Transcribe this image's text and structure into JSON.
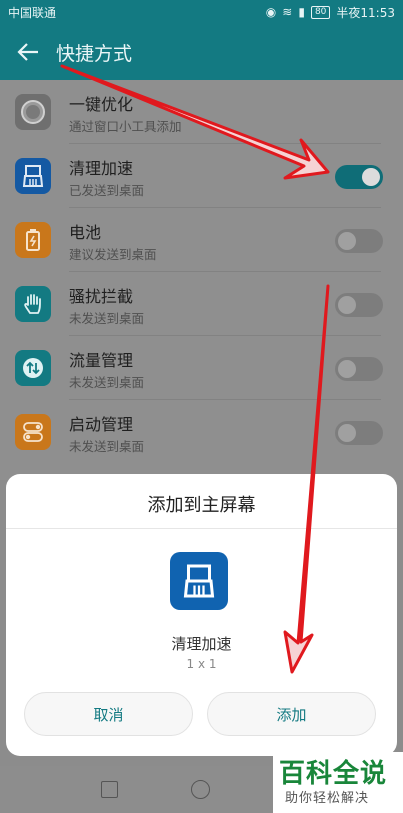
{
  "status_bar": {
    "carrier": "中国联通",
    "battery": "80",
    "time": "半夜11:53"
  },
  "app_bar": {
    "title": "快捷方式"
  },
  "shortcuts": [
    {
      "name": "一键优化",
      "status": "通过窗口小工具添加",
      "icon": "optimize-icon",
      "color": "#6f6f6f",
      "enabled": null
    },
    {
      "name": "清理加速",
      "status": "已发送到桌面",
      "icon": "broom-icon",
      "color": "#1459a3",
      "enabled": true
    },
    {
      "name": "电池",
      "status": "建议发送到桌面",
      "icon": "battery-icon",
      "color": "#c9771b",
      "enabled": false
    },
    {
      "name": "骚扰拦截",
      "status": "未发送到桌面",
      "icon": "hand-icon",
      "color": "#137a82",
      "enabled": false
    },
    {
      "name": "流量管理",
      "status": "未发送到桌面",
      "icon": "data-traffic-icon",
      "color": "#137a82",
      "enabled": false
    },
    {
      "name": "启动管理",
      "status": "未发送到桌面",
      "icon": "startup-icon",
      "color": "#c9771b",
      "enabled": false
    }
  ],
  "dialog": {
    "title": "添加到主屏幕",
    "app_name": "清理加速",
    "app_size": "1 x 1",
    "cancel_label": "取消",
    "add_label": "添加"
  },
  "watermark": {
    "brand": "百科全说",
    "tagline": "助你轻松解决"
  },
  "colors": {
    "accent": "#137a82",
    "annotation": "#e0191e"
  }
}
